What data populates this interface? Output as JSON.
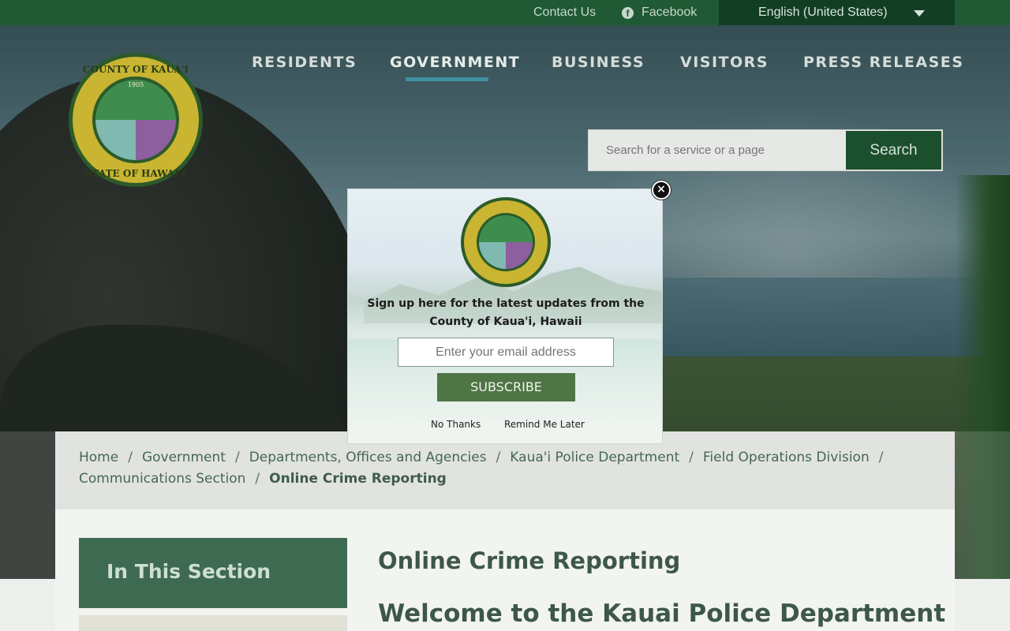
{
  "topbar": {
    "contact_label": "Contact Us",
    "facebook_label": "Facebook",
    "language_selected": "English (United States)"
  },
  "logo": {
    "top_text": "COUNTY OF KAUA'I",
    "bottom_text": "STATE OF HAWAI'I",
    "year": "1905"
  },
  "nav": {
    "items": [
      {
        "label": "RESIDENTS"
      },
      {
        "label": "GOVERNMENT"
      },
      {
        "label": "BUSINESS"
      },
      {
        "label": "VISITORS"
      },
      {
        "label": "PRESS RELEASES"
      }
    ],
    "active": "GOVERNMENT"
  },
  "search": {
    "placeholder": "Search for a service or a page",
    "button_label": "Search"
  },
  "breadcrumb": {
    "items": [
      "Home",
      "Government",
      "Departments, Offices and Agencies",
      "Kaua'i Police Department",
      "Field Operations Division",
      "Communications Section"
    ],
    "current": "Online Crime Reporting"
  },
  "sidebar": {
    "heading": "In This Section"
  },
  "main": {
    "title": "Online Crime Reporting",
    "welcome": "Welcome to the Kauai Police Department"
  },
  "popup": {
    "message": "Sign up here for the latest updates from the County of Kaua'i, Hawaii",
    "email_placeholder": "Enter your email address",
    "subscribe_label": "SUBSCRIBE",
    "no_thanks_label": "No Thanks",
    "remind_label": "Remind Me Later",
    "close_glyph": "×"
  },
  "colors": {
    "brand_green": "#1f5a35",
    "accent_teal": "#3f8fa0",
    "subscribe_green": "#4f7544"
  }
}
